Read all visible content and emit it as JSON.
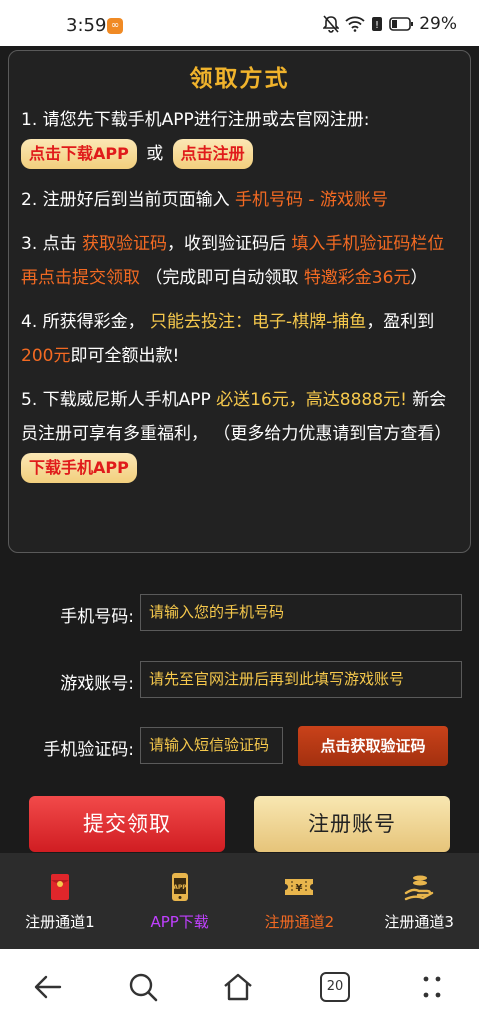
{
  "statusbar": {
    "time": "3:59",
    "battery_text": "29%",
    "icons": [
      "mute-icon",
      "wifi-icon",
      "battery-icon"
    ]
  },
  "card": {
    "title": "领取方式",
    "step1": {
      "text": "1. 请您先下载手机APP进行注册或去官网注册:",
      "btn_download": "点击下载APP",
      "or": "或",
      "btn_register": "点击注册"
    },
    "step2": {
      "text": "2. 注册好后到当前页面输入 ",
      "highlight": "手机号码 - 游戏账号"
    },
    "step3": {
      "pre": "3. 点击 ",
      "hl1": "获取验证码",
      "mid": "，收到验证码后 ",
      "hl2": "填入手机验证码栏位再点击提交领取",
      "mid2": " （完成即可自动领取 ",
      "hl3": "特邀彩金36元",
      "post": "）"
    },
    "step4": {
      "pre": "4. 所获得彩金， ",
      "yl1": "只能去投注：电子-棋牌-捕鱼",
      "mid": "，盈利到 ",
      "hl1": "200元",
      "post": "即可全额出款!"
    },
    "step5": {
      "pre": "5. 下载威尼斯人手机APP ",
      "yl1": "必送16元，高达8888元!",
      "mid": " 新会员注册可享有多重福利， （更多给力优惠请到官方查看）",
      "btn": "下载手机APP"
    }
  },
  "form": {
    "phone_label": "手机号码:",
    "phone_placeholder": "请输入您的手机号码",
    "account_label": "游戏账号:",
    "account_placeholder": "请先至官网注册后再到此填写游戏账号",
    "code_label": "手机验证码:",
    "code_placeholder": "请输入短信验证码",
    "code_button": "点击获取验证码",
    "submit_button": "提交领取",
    "register_button": "注册账号"
  },
  "tabbar": {
    "items": [
      {
        "label": "注册通道1",
        "color": "#ffffff",
        "icon": "red-envelope-icon"
      },
      {
        "label": "APP下载",
        "color": "#c040ff",
        "icon": "app-phone-icon"
      },
      {
        "label": "注册通道2",
        "color": "#f36a22",
        "icon": "ticket-icon"
      },
      {
        "label": "注册通道3",
        "color": "#ffffff",
        "icon": "coin-hand-icon"
      }
    ]
  },
  "sysnav": {
    "tabs_count": "20",
    "icons": [
      "back-icon",
      "search-icon",
      "home-icon",
      "tabs-icon",
      "more-icon"
    ]
  }
}
